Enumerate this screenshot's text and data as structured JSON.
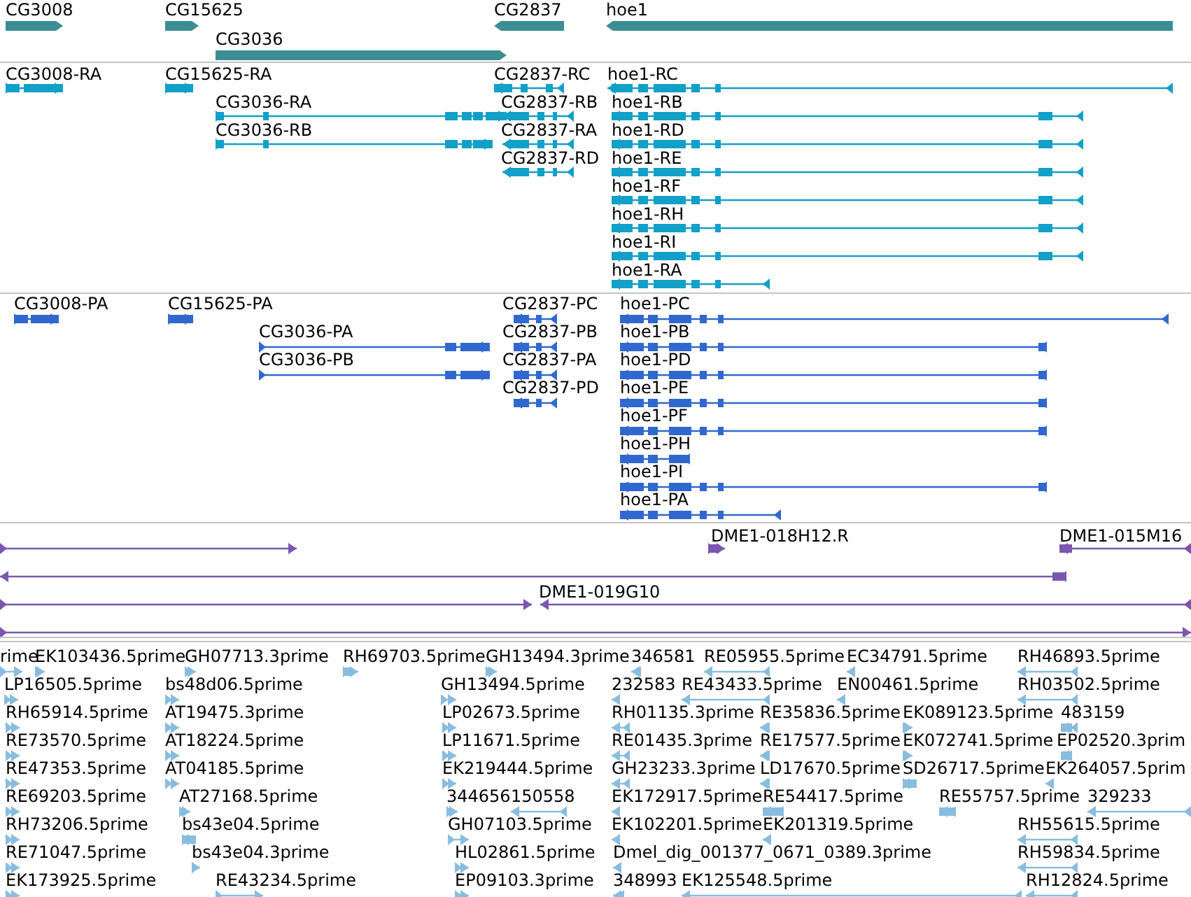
{
  "tracks": [
    {
      "kind": "gene",
      "features": [
        {
          "label": "CG3008",
          "reverse": false
        },
        {
          "label": "CG15625",
          "reverse": false
        },
        {
          "label": "CG2837",
          "reverse": true
        },
        {
          "label": "hoe1",
          "reverse": true
        },
        {
          "label": "CG3036",
          "reverse": false
        }
      ]
    },
    {
      "kind": "transcript",
      "features": [
        {
          "label": "CG3008-RA",
          "reverse": false
        },
        {
          "label": "CG15625-RA",
          "reverse": false
        },
        {
          "label": "CG2837-RC",
          "reverse": true
        },
        {
          "label": "hoe1-RC",
          "reverse": true
        },
        {
          "label": "CG3036-RA",
          "reverse": false
        },
        {
          "label": "CG2837-RB",
          "reverse": true
        },
        {
          "label": "hoe1-RB",
          "reverse": true
        },
        {
          "label": "CG3036-RB",
          "reverse": false
        },
        {
          "label": "CG2837-RA",
          "reverse": true
        },
        {
          "label": "hoe1-RD",
          "reverse": true
        },
        {
          "label": "CG2837-RD",
          "reverse": true
        },
        {
          "label": "hoe1-RE",
          "reverse": true
        },
        {
          "label": "hoe1-RF",
          "reverse": true
        },
        {
          "label": "hoe1-RH",
          "reverse": true
        },
        {
          "label": "hoe1-RI",
          "reverse": true
        },
        {
          "label": "hoe1-RA",
          "reverse": true
        }
      ]
    },
    {
      "kind": "protein",
      "features": [
        {
          "label": "CG3008-PA",
          "reverse": false
        },
        {
          "label": "CG15625-PA",
          "reverse": false
        },
        {
          "label": "CG2837-PC",
          "reverse": true
        },
        {
          "label": "hoe1-PC",
          "reverse": true
        },
        {
          "label": "CG3036-PA",
          "reverse": false
        },
        {
          "label": "CG2837-PB",
          "reverse": true
        },
        {
          "label": "hoe1-PB",
          "reverse": true
        },
        {
          "label": "CG3036-PB",
          "reverse": false
        },
        {
          "label": "CG2837-PA",
          "reverse": true
        },
        {
          "label": "hoe1-PD",
          "reverse": true
        },
        {
          "label": "CG2837-PD",
          "reverse": true
        },
        {
          "label": "hoe1-PE",
          "reverse": true
        },
        {
          "label": "hoe1-PF",
          "reverse": true
        },
        {
          "label": "hoe1-PH",
          "reverse": true
        },
        {
          "label": "hoe1-PI",
          "reverse": true
        },
        {
          "label": "hoe1-PA",
          "reverse": true
        }
      ]
    },
    {
      "kind": "clone",
      "features": [
        {
          "reverse": false
        },
        {
          "label": "DME1-018H12.R",
          "reverse": false
        },
        {
          "label": "DME1-015M16",
          "reverse": true
        },
        {
          "reverse": true
        },
        {
          "reverse": false
        },
        {
          "label": "DME1-019G10",
          "reverse": true
        },
        {
          "reverse": false
        }
      ]
    },
    {
      "kind": "est",
      "features": [
        {
          "label": "rime",
          "reverse": false
        },
        {
          "label": "EK103436.5prime",
          "reverse": false
        },
        {
          "label": "GH07713.3prime",
          "reverse": false
        },
        {
          "label": "RH69703.5prime",
          "reverse": false
        },
        {
          "label": "GH13494.3prime",
          "reverse": false
        },
        {
          "label": "346581",
          "reverse": true
        },
        {
          "label": "RE05955.5prime",
          "reverse": true
        },
        {
          "label": "EC34791.5prime",
          "reverse": true
        },
        {
          "label": "RH46893.5prime",
          "reverse": true
        },
        {
          "label": "LP16505.5prime",
          "reverse": false
        },
        {
          "label": "bs48d06.5prime",
          "reverse": false
        },
        {
          "label": "GH13494.5prime",
          "reverse": false
        },
        {
          "label": "232583",
          "reverse": true
        },
        {
          "label": "RE43433.5prime",
          "reverse": true
        },
        {
          "label": "EN00461.5prime",
          "reverse": true
        },
        {
          "label": "RH03502.5prime",
          "reverse": true
        },
        {
          "label": "RH65914.5prime",
          "reverse": false
        },
        {
          "label": "AT19475.3prime",
          "reverse": false
        },
        {
          "label": "LP02673.5prime",
          "reverse": false
        },
        {
          "label": "RH01135.3prime",
          "reverse": true
        },
        {
          "label": "RE35836.5prime",
          "reverse": true
        },
        {
          "label": "EK089123.5prime",
          "reverse": false
        },
        {
          "label": "483159",
          "reverse": true
        },
        {
          "label": "RE73570.5prime",
          "reverse": false
        },
        {
          "label": "AT18224.5prime",
          "reverse": false
        },
        {
          "label": "LP11671.5prime",
          "reverse": false
        },
        {
          "label": "RE01435.3prime",
          "reverse": true
        },
        {
          "label": "RE17577.5prime",
          "reverse": true
        },
        {
          "label": "EK072741.5prime",
          "reverse": false
        },
        {
          "label": "EP02520.3prim",
          "reverse": true
        },
        {
          "label": "RE47353.5prime",
          "reverse": false
        },
        {
          "label": "AT04185.5prime",
          "reverse": false
        },
        {
          "label": "EK219444.5prime",
          "reverse": false
        },
        {
          "label": "GH23233.3prime",
          "reverse": true
        },
        {
          "label": "LD17670.5prime",
          "reverse": true
        },
        {
          "label": "SD26717.5prime",
          "reverse": false
        },
        {
          "label": "EK264057.5prim",
          "reverse": true
        },
        {
          "label": "RE69203.5prime",
          "reverse": false
        },
        {
          "label": "AT27168.5prime",
          "reverse": false
        },
        {
          "label": "344656",
          "reverse": false
        },
        {
          "label": "150558",
          "reverse": true
        },
        {
          "label": "EK172917.5prime",
          "reverse": true
        },
        {
          "label": "RE54417.5prime",
          "reverse": true
        },
        {
          "label": "RE55757.5prime",
          "reverse": true
        },
        {
          "label": "329233",
          "reverse": true
        },
        {
          "label": "RH73206.5prime",
          "reverse": false
        },
        {
          "label": "bs43e04.5prime",
          "reverse": false
        },
        {
          "label": "GH07103.5prime",
          "reverse": false
        },
        {
          "label": "EK102201.5prime",
          "reverse": true
        },
        {
          "label": "EK201319.5prime",
          "reverse": true
        },
        {
          "label": "RH55615.5prime",
          "reverse": true
        },
        {
          "label": "RE71047.5prime",
          "reverse": false
        },
        {
          "label": "bs43e04.3prime",
          "reverse": false
        },
        {
          "label": "HL02861.5prime",
          "reverse": false
        },
        {
          "label": "Dmel_dig_001377_0671_0389.3prime",
          "reverse": true
        },
        {
          "label": "RH59834.5prime",
          "reverse": true
        },
        {
          "label": "EK173925.5prime",
          "reverse": false
        },
        {
          "label": "RE43234.5prime",
          "reverse": false
        },
        {
          "label": "EP09103.3prime",
          "reverse": false
        },
        {
          "label": "348993",
          "reverse": true
        },
        {
          "label": "EK125548.5prime",
          "reverse": true
        },
        {
          "label": "RH12824.5prime",
          "reverse": true
        }
      ]
    }
  ]
}
